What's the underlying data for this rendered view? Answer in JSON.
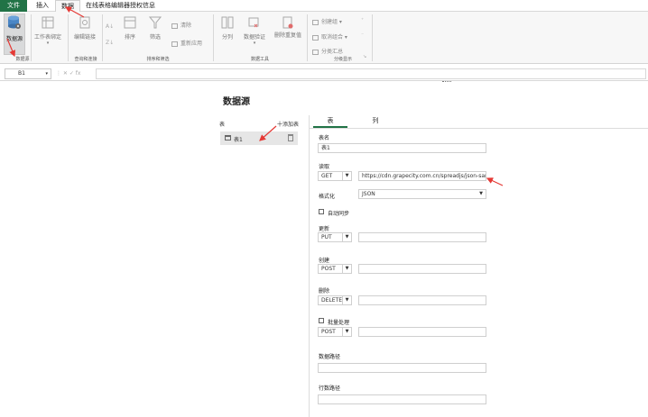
{
  "ribbon": {
    "tabs": {
      "file": "文件",
      "insert": "插入",
      "data": "数据",
      "online": "在线表格编辑器授权信息"
    },
    "buttons": {
      "datasource": "数据源",
      "workbook_settings": "工作表绑定",
      "edit_link": "编辑链接",
      "sort": "排序",
      "filter": "筛选",
      "clear": "清除",
      "reapply": "重新应用",
      "split": "分列",
      "data_validation": "数据验证",
      "remove_duplicates": "删除重复值",
      "create_group": "创建组",
      "ungroup": "取消组合",
      "subtotal": "分类汇总"
    },
    "groups": {
      "datasource": "数据源",
      "query_connect": "查询和连接",
      "sort_filter": "排序和筛选",
      "data_tools": "数据工具",
      "outline": "分级显示"
    }
  },
  "formula_bar": {
    "cell_ref": "B1",
    "fx_text": "⋮ ✕ ✓ fx",
    "value": ""
  },
  "panel": {
    "title": "数据源",
    "tables_label": "表",
    "add_table": "十添加表",
    "table_items": [
      {
        "name": "表1"
      }
    ],
    "tabs": [
      "表",
      "列"
    ],
    "active_tab": "表",
    "fields": {
      "table_name_label": "表名",
      "table_name_value": "表1",
      "read_label": "读取",
      "read_method": "GET",
      "read_url": "https://cdn.grapecity.com.cn/spreadjs/json-sampl",
      "format_label": "格式化",
      "format_value": "JSON",
      "auto_sync_label": "自动同步",
      "update_label": "更新",
      "update_method": "PUT",
      "update_url": "",
      "create_label": "创建",
      "create_method": "POST",
      "create_url": "",
      "delete_label": "删除",
      "delete_method": "DELETE",
      "delete_url": "",
      "batch_label": "批量处理",
      "batch_method": "POST",
      "batch_url": "",
      "data_path_label": "数据路径",
      "data_path_value": "",
      "row_path_label": "行数路径",
      "row_path_value": ""
    }
  },
  "colors": {
    "file_tab": "#217346",
    "arrow": "#e53935",
    "accent": "#217346",
    "icon_blue": "#4a86c5"
  }
}
